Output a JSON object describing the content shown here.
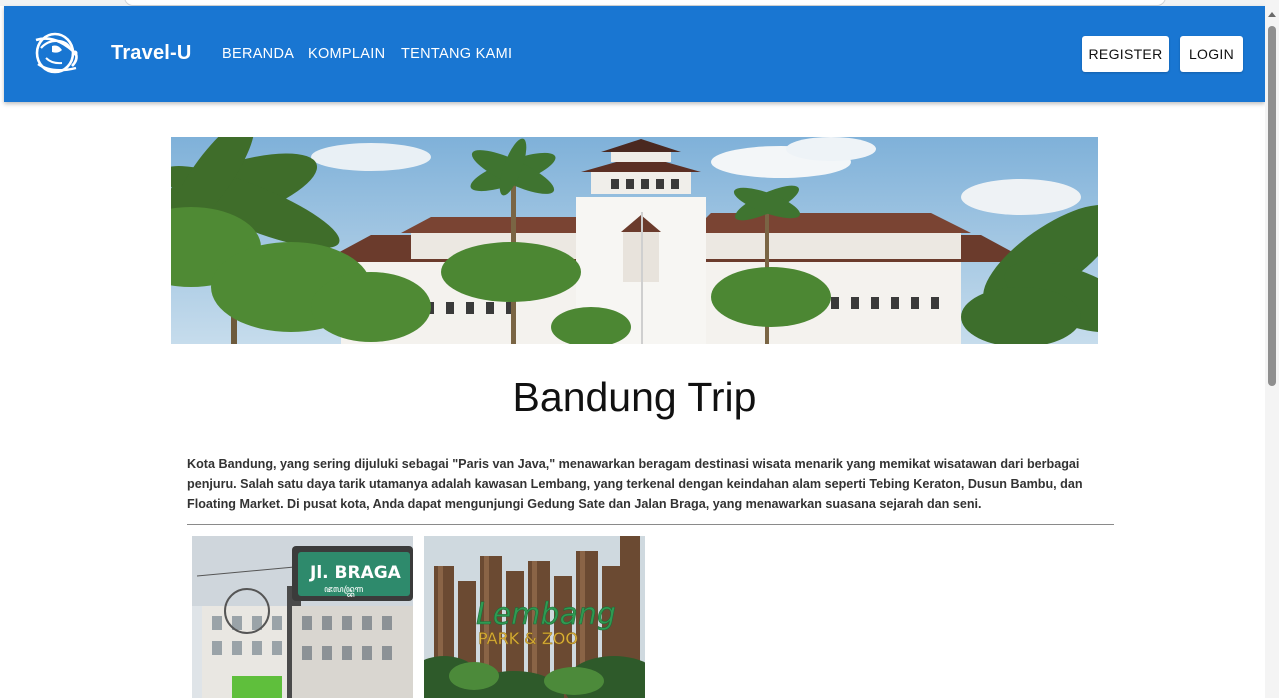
{
  "navbar": {
    "brand": "Travel-U",
    "links": [
      "BERANDA",
      "KOMPLAIN",
      "TENTANG KAMI"
    ],
    "register_label": "REGISTER",
    "login_label": "LOGIN",
    "logo_icon": "globe-travel-icon",
    "background": "#1976d2"
  },
  "main": {
    "title": "Bandung Trip",
    "description": "Kota Bandung, yang sering dijuluki sebagai \"Paris van Java,\" menawarkan beragam destinasi wisata menarik yang memikat wisatawan dari berbagai penjuru. Salah satu daya tarik utamanya adalah kawasan Lembang, yang terkenal dengan keindahan alam seperti Tebing Keraton, Dusun Bambu, dan Floating Market. Di pusat kota, Anda dapat mengunjungi Gedung Sate dan Jalan Braga, yang menawarkan suasana sejarah dan seni."
  },
  "cards": [
    {
      "sign_line1": "Jl. BRAGA",
      "sign_line2": "ꦗꦭꦤ꧀ꦧꦿꦒ"
    },
    {
      "sign_line1": "Lembang",
      "sign_line2": "PARK & ZOO"
    }
  ]
}
